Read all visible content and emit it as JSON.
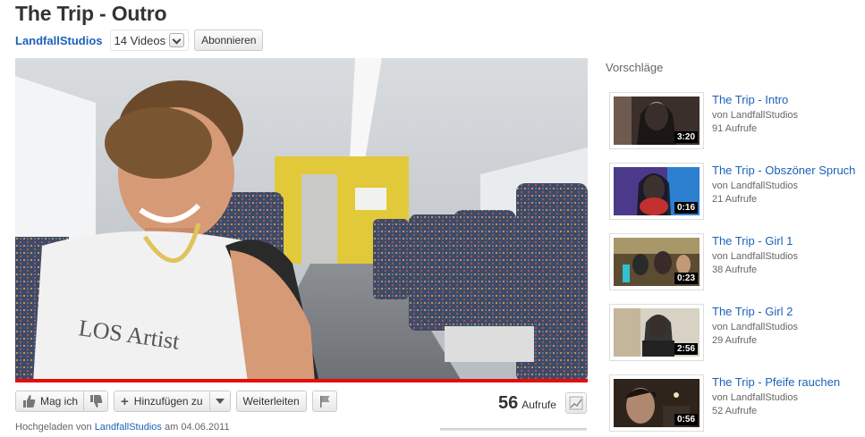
{
  "video": {
    "title": "The Trip - Outro",
    "channel": "LandfallStudios",
    "videos_count": "14 Videos",
    "subscribe_label": "Abonnieren"
  },
  "actions": {
    "like_label": "Mag ich",
    "add_label": "Hinzufügen zu",
    "share_label": "Weiterleiten"
  },
  "stats": {
    "views": "56",
    "views_label": "Aufrufe"
  },
  "upload": {
    "prefix": "Hochgeladen von",
    "user": "LandfallStudios",
    "date_text": "am 04.06.2011"
  },
  "sidebar": {
    "title": "Vorschläge",
    "items": [
      {
        "title": "The Trip - Intro",
        "by": "von LandfallStudios",
        "views": "91 Aufrufe",
        "duration": "3:20"
      },
      {
        "title": "The Trip - Obszöner Spruch",
        "by": "von LandfallStudios",
        "views": "21 Aufrufe",
        "duration": "0:16"
      },
      {
        "title": "The Trip - Girl 1",
        "by": "von LandfallStudios",
        "views": "38 Aufrufe",
        "duration": "0:23"
      },
      {
        "title": "The Trip - Girl 2",
        "by": "von LandfallStudios",
        "views": "29 Aufrufe",
        "duration": "2:56"
      },
      {
        "title": "The Trip - Pfeife rauchen",
        "by": "von LandfallStudios",
        "views": "52 Aufrufe",
        "duration": "0:56"
      }
    ]
  },
  "colors": {
    "link": "#1c62b9",
    "progress": "#e40d0d"
  }
}
